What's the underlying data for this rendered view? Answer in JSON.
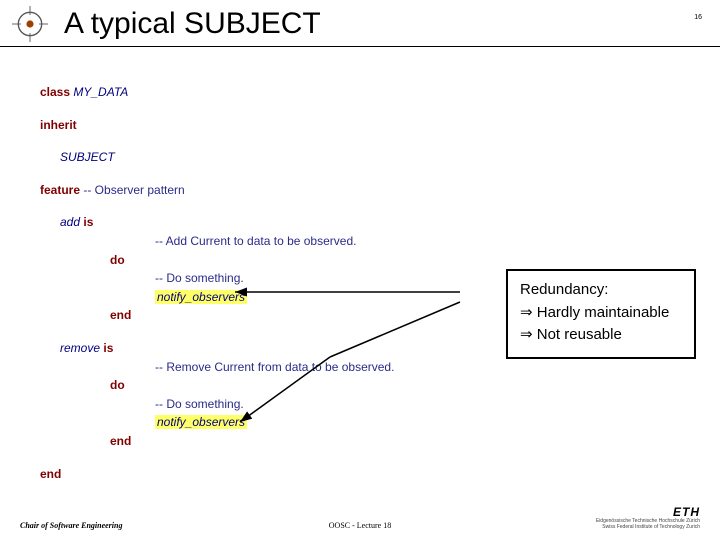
{
  "header": {
    "title": "A typical SUBJECT",
    "slide_number": "16"
  },
  "code": {
    "class_kw": "class",
    "class_name": "MY_DATA",
    "inherit_kw": "inherit",
    "parent": "SUBJECT",
    "feature_kw": "feature",
    "feature_cmt": "-- Observer pattern",
    "add_name": "add",
    "is_kw": "is",
    "add_cmt": "-- Add Current to data to be observed.",
    "do_kw": "do",
    "do_something": "-- Do something.",
    "notify": "notify_observers",
    "end_kw": "end",
    "remove_name": "remove",
    "remove_cmt": "-- Remove Current from data to be observed.",
    "final_end": "end"
  },
  "callout": {
    "title": "Redundancy",
    "colon": ":",
    "line1": "Hardly maintainable",
    "line2": "Not reusable",
    "arrow": "⇒"
  },
  "footer": {
    "left": "Chair of Software Engineering",
    "center": "OOSC - Lecture 18",
    "eth": "ETH",
    "ethsub1": "Eidgenössische Technische Hochschule Zürich",
    "ethsub2": "Swiss Federal Institute of Technology Zurich"
  }
}
